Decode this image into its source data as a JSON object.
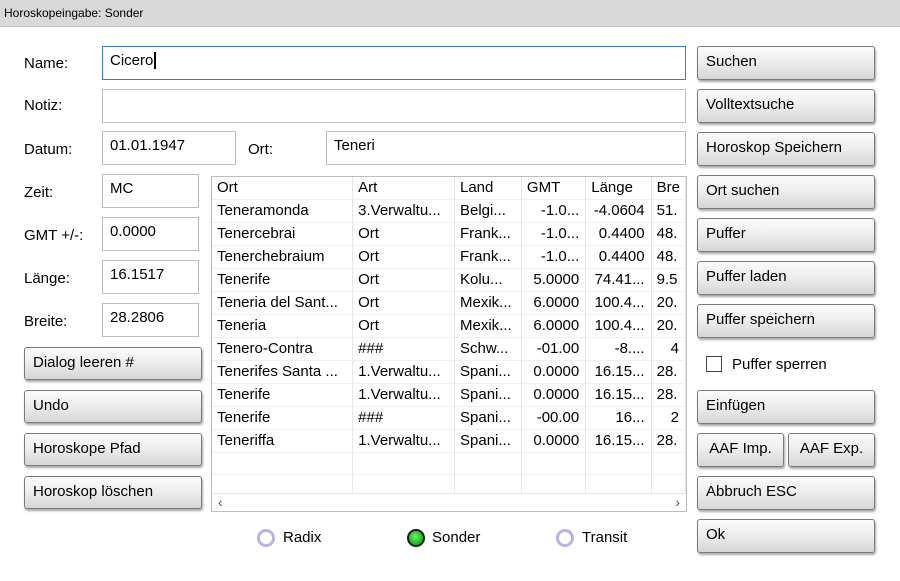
{
  "window": {
    "title": "Horoskopeingabe: Sonder"
  },
  "form": {
    "name_label": "Name:",
    "name_value": "Cicero",
    "notiz_label": "Notiz:",
    "notiz_value": "",
    "datum_label": "Datum:",
    "datum_value": "01.01.1947",
    "ort_label": "Ort:",
    "ort_value": "Teneri",
    "zeit_label": "Zeit:",
    "zeit_value": "MC",
    "gmt_label": "GMT +/-:",
    "gmt_value": "0.0000",
    "laenge_label": "Länge:",
    "laenge_value": "16.1517",
    "breite_label": "Breite:",
    "breite_value": "28.2806"
  },
  "left_buttons": {
    "dialog_leeren": "Dialog leeren #",
    "undo": "Undo",
    "horoskope_pfad": "Horoskope Pfad",
    "horoskop_loeschen": "Horoskop löschen"
  },
  "results": {
    "columns": [
      "Ort",
      "Art",
      "Land",
      "GMT",
      "Länge",
      "Bre"
    ],
    "rows": [
      [
        "Teneramonda",
        "3.Verwaltu...",
        "Belgi...",
        "-1.0...",
        "-4.0604",
        "51."
      ],
      [
        "Tenercebrai",
        "Ort",
        "Frank...",
        "-1.0...",
        "0.4400",
        "48."
      ],
      [
        "Tenerchebraium",
        "Ort",
        "Frank...",
        "-1.0...",
        "0.4400",
        "48."
      ],
      [
        "Tenerife",
        "Ort",
        "Kolu...",
        "5.0000",
        "74.41...",
        "9.5"
      ],
      [
        "Teneria del Sant...",
        "Ort",
        "Mexik...",
        "6.0000",
        "100.4...",
        "20."
      ],
      [
        "Teneria",
        "Ort",
        "Mexik...",
        "6.0000",
        "100.4...",
        "20."
      ],
      [
        "Tenero-Contra",
        "###",
        "Schw...",
        "-01.00",
        "-8....",
        "4"
      ],
      [
        "Tenerifes Santa ...",
        "1.Verwaltu...",
        "Spani...",
        "0.0000",
        "16.15...",
        "28."
      ],
      [
        "Tenerife",
        "1.Verwaltu...",
        "Spani...",
        "0.0000",
        "16.15...",
        "28."
      ],
      [
        "Tenerife",
        "###",
        "Spani...",
        "-00.00",
        "16...",
        "2"
      ],
      [
        "Teneriffa",
        "1.Verwaltu...",
        "Spani...",
        "0.0000",
        "16.15...",
        "28."
      ]
    ],
    "scroll_left": "‹",
    "scroll_right": "›"
  },
  "right_buttons": {
    "suchen": "Suchen",
    "volltextsuche": "Volltextsuche",
    "horoskop_speichern": "Horoskop Speichern",
    "ort_suchen": "Ort suchen",
    "puffer": "Puffer",
    "puffer_laden": "Puffer laden",
    "puffer_speichern": "Puffer speichern",
    "puffer_sperren": "Puffer sperren",
    "einfuegen": "Einfügen",
    "aaf_imp": "AAF Imp.",
    "aaf_exp": "AAF Exp.",
    "abbruch": "Abbruch ESC",
    "ok": "Ok"
  },
  "mode": {
    "options": [
      "Radix",
      "Sonder",
      "Transit"
    ],
    "selected": "Sonder"
  },
  "colors": {
    "focus_border": "#3b7bd1",
    "radio_selected": "#22c322",
    "radio_unselected": "#b8b2e6"
  }
}
